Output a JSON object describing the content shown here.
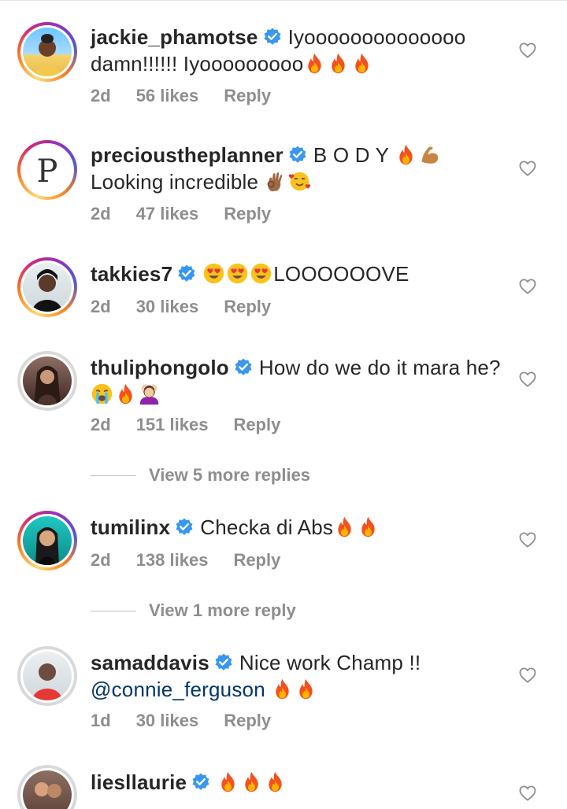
{
  "comments": [
    {
      "username": "jackie_phamotse",
      "text_line1": "Iyoooooooooooooo",
      "text_line2": "damn!!!!!! Iyooooooooo",
      "emojis": "🔥🔥🔥",
      "age": "2d",
      "likes": "56 likes",
      "reply": "Reply"
    },
    {
      "username": "precioustheplanner",
      "text_line1": "B O D Y",
      "emojis1": "🔥💪",
      "text_line2": "Looking incredible",
      "emojis2": "👌🥰",
      "age": "2d",
      "likes": "47 likes",
      "reply": "Reply"
    },
    {
      "username": "takkies7",
      "emojis": "😍😍😍",
      "text": "LOOOOOOVE",
      "age": "2d",
      "likes": "30 likes",
      "reply": "Reply"
    },
    {
      "username": "thuliphongolo",
      "text": "How do we do it mara he?",
      "emojis": "😭🔥🙆",
      "age": "2d",
      "likes": "151 likes",
      "reply": "Reply",
      "view_more": "View 5 more replies"
    },
    {
      "username": "tumilinx",
      "text": "Checka di Abs",
      "emojis": "🔥🔥",
      "age": "2d",
      "likes": "138 likes",
      "reply": "Reply",
      "view_more": "View 1 more reply"
    },
    {
      "username": "samaddavis",
      "text": "Nice work Champ !!",
      "mention": "@connie_ferguson",
      "emojis": "🔥🔥",
      "age": "1d",
      "likes": "30 likes",
      "reply": "Reply"
    },
    {
      "username": "liesllaurie",
      "emojis": "🔥🔥🔥"
    }
  ],
  "colors": {
    "verified": "#3897f0",
    "meta_text": "#8e8e8e",
    "mention": "#00376b"
  },
  "icons": {
    "like": "heart-outline-icon",
    "verified": "verified-badge-icon"
  }
}
